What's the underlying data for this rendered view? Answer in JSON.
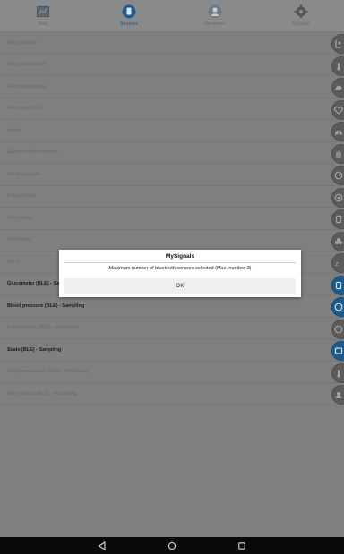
{
  "tabs": [
    {
      "label": "Data",
      "icon": "data-icon",
      "active": false
    },
    {
      "label": "Sensors",
      "icon": "sensors-icon",
      "active": true
    },
    {
      "label": "Members",
      "icon": "members-icon",
      "active": false
    },
    {
      "label": "Settings",
      "icon": "settings-icon",
      "active": false
    }
  ],
  "sensors": [
    {
      "name": "Body position",
      "active": false,
      "icon": "body-position-icon"
    },
    {
      "name": "Body temperature",
      "active": false,
      "icon": "thermometer-icon"
    },
    {
      "name": "Electromyography",
      "active": false,
      "icon": "muscle-icon"
    },
    {
      "name": "Heart rate/ECG",
      "active": false,
      "icon": "heart-icon"
    },
    {
      "name": "Airflow",
      "active": false,
      "icon": "lungs-icon"
    },
    {
      "name": "Galvanic skin response",
      "active": false,
      "icon": "hand-icon"
    },
    {
      "name": "Blood pressure",
      "active": false,
      "icon": "pressure-gauge-icon"
    },
    {
      "name": "Pulsioximeter",
      "active": false,
      "icon": "pulse-icon"
    },
    {
      "name": "Glucometer",
      "active": false,
      "icon": "glucometer-icon"
    },
    {
      "name": "Spirometer",
      "active": false,
      "icon": "spirometer-icon"
    },
    {
      "name": "Snore",
      "active": false,
      "icon": "snore-icon"
    },
    {
      "name": "Glucometer (BLE) - Sampling",
      "active": true,
      "icon": "bluetooth-glucometer-icon"
    },
    {
      "name": "Blood pressure (BLE) - Sampling",
      "active": true,
      "icon": "bluetooth-pressure-icon"
    },
    {
      "name": "Pulsioximeter (BLE) - Monitoring",
      "active": false,
      "icon": "bluetooth-pulse-icon"
    },
    {
      "name": "Scale (BLE) - Sampling",
      "active": true,
      "icon": "bluetooth-scale-icon"
    },
    {
      "name": "Body temperature (BLE) - Monitoring",
      "active": false,
      "icon": "bluetooth-thermometer-icon"
    },
    {
      "name": "Alarm button (BLE) - Monitoring",
      "active": false,
      "icon": "bluetooth-alarm-icon"
    }
  ],
  "dialog": {
    "title": "MySignals",
    "message": "Maximum number of bluetooth sensors selected (Max. number 3)",
    "ok_label": "OK"
  },
  "colors": {
    "active_accent": "#1e5a8c",
    "dim_overlay": "#7f7f7f"
  }
}
